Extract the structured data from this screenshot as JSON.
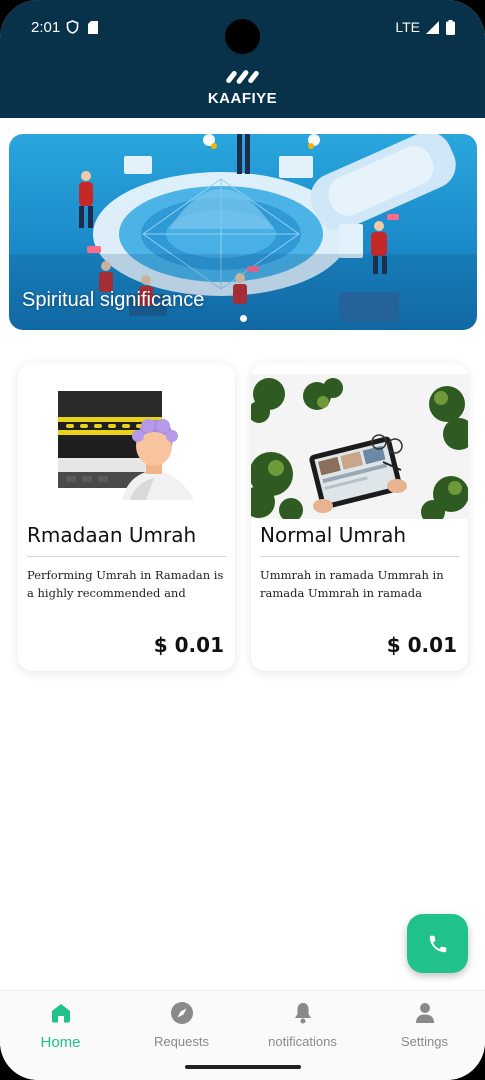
{
  "status_bar": {
    "time": "2:01",
    "network": "LTE"
  },
  "header": {
    "logo_text": "KAAFIYE"
  },
  "banner": {
    "title": "Spiritual significance",
    "active_slide": 1
  },
  "cards": [
    {
      "title": "Rmadaan Umrah",
      "description": "Performing Umrah in Ramadan is a highly recommended and",
      "price": "$ 0.01",
      "icon": "kaaba-pilgrim-illustration"
    },
    {
      "title": "Normal Umrah",
      "description": "Ummrah in ramada Ummrah in ramada Ummrah in ramada",
      "price": "$ 0.01",
      "icon": "tablet-desk-photo"
    }
  ],
  "fab": {
    "icon": "phone-icon"
  },
  "bottom_nav": {
    "items": [
      {
        "label": "Home",
        "icon": "home-icon",
        "active": true
      },
      {
        "label": "Requests",
        "icon": "compass-icon",
        "active": false
      },
      {
        "label": "notifications",
        "icon": "bell-icon",
        "active": false
      },
      {
        "label": "Settings",
        "icon": "person-icon",
        "active": false
      }
    ]
  },
  "colors": {
    "header_bg": "#07324a",
    "accent": "#21c28a",
    "inactive": "#8a8a8a"
  }
}
